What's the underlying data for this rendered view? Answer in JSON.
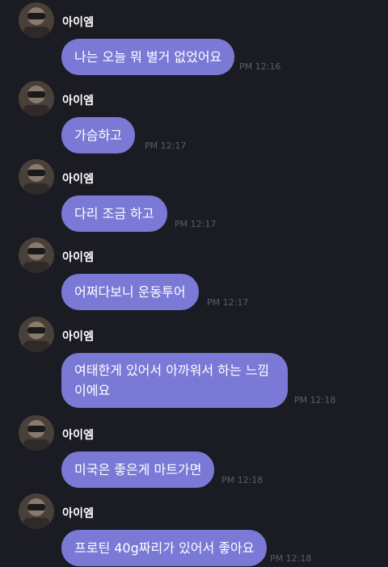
{
  "sender_name": "아이엠",
  "messages": [
    {
      "text": "나는 오늘 뭐 별거 없었어요",
      "time": "PM 12:16"
    },
    {
      "text": "가슴하고",
      "time": "PM 12:17"
    },
    {
      "text": "다리 조금 하고",
      "time": "PM 12:17"
    },
    {
      "text": "어쩌다보니 운동투어",
      "time": "PM 12:17"
    },
    {
      "text": "여태한게 있어서 아까워서 하는 느낌 이에요",
      "time": "PM 12:18"
    },
    {
      "text": "미국은 좋은게 마트가면",
      "time": "PM 12:18"
    },
    {
      "text": "프로틴 40g짜리가 있어서 좋아요",
      "time": "PM 12:18"
    }
  ],
  "colors": {
    "background": "#1b1b23",
    "bubble": "#7b79d6",
    "timestamp": "#5d5d66"
  },
  "icons": {
    "avatar": "profile-avatar-icon"
  }
}
